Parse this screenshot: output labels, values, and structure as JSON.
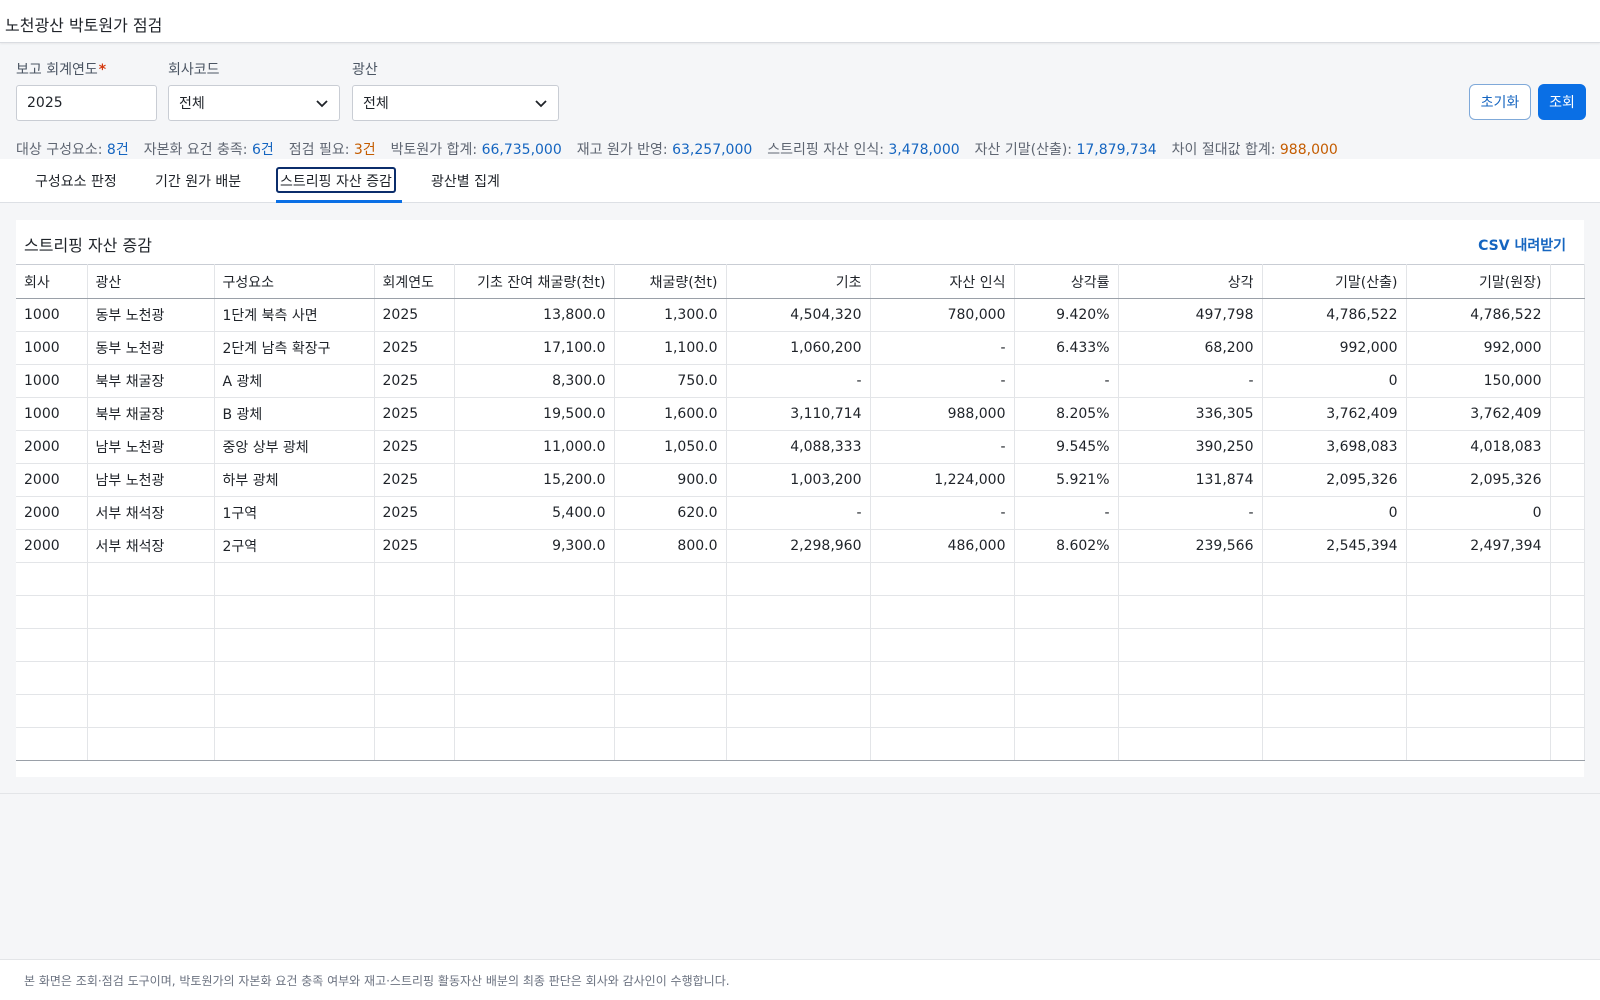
{
  "header": {
    "title": "노천광산 박토원가 점검"
  },
  "filters": {
    "year": {
      "label": "보고 회계연도",
      "required_mark": "*",
      "value": "2025"
    },
    "company": {
      "label": "회사코드",
      "value": "전체"
    },
    "mine": {
      "label": "광산",
      "value": "전체"
    },
    "reset_label": "초기화",
    "search_label": "조회"
  },
  "summary": [
    {
      "label": "대상 구성요소: ",
      "value": "8건",
      "tone": "blue"
    },
    {
      "label": "자본화 요건 충족: ",
      "value": "6건",
      "tone": "blue"
    },
    {
      "label": "점검 필요: ",
      "value": "3건",
      "tone": "orange"
    },
    {
      "label": "박토원가 합계: ",
      "value": "66,735,000",
      "tone": "blue"
    },
    {
      "label": "재고 원가 반영: ",
      "value": "63,257,000",
      "tone": "blue"
    },
    {
      "label": "스트리핑 자산 인식: ",
      "value": "3,478,000",
      "tone": "blue"
    },
    {
      "label": "자산 기말(산출): ",
      "value": "17,879,734",
      "tone": "blue"
    },
    {
      "label": "차이 절대값 합계: ",
      "value": "988,000",
      "tone": "orange"
    }
  ],
  "tabs": [
    "구성요소 판정",
    "기간 원가 배분",
    "스트리핑 자산 증감",
    "광산별 집계"
  ],
  "active_tab": 2,
  "panel": {
    "title": "스트리핑 자산 증감",
    "csv_label": "CSV 내려받기",
    "columns": [
      "회사",
      "광산",
      "구성요소",
      "회계연도",
      "기초 잔여 채굴량(천t)",
      "채굴량(천t)",
      "기초",
      "자산 인식",
      "상각률",
      "상각",
      "기말(산출)",
      "기말(원장)"
    ],
    "rows": [
      [
        "1000",
        "동부 노천광",
        "1단계 북측 사면",
        "2025",
        "13,800.0",
        "1,300.0",
        "4,504,320",
        "780,000",
        "9.420%",
        "497,798",
        "4,786,522",
        "4,786,522"
      ],
      [
        "1000",
        "동부 노천광",
        "2단계 남측 확장구",
        "2025",
        "17,100.0",
        "1,100.0",
        "1,060,200",
        "-",
        "6.433%",
        "68,200",
        "992,000",
        "992,000"
      ],
      [
        "1000",
        "북부 채굴장",
        "A 광체",
        "2025",
        "8,300.0",
        "750.0",
        "-",
        "-",
        "-",
        "-",
        "0",
        "150,000"
      ],
      [
        "1000",
        "북부 채굴장",
        "B 광체",
        "2025",
        "19,500.0",
        "1,600.0",
        "3,110,714",
        "988,000",
        "8.205%",
        "336,305",
        "3,762,409",
        "3,762,409"
      ],
      [
        "2000",
        "남부 노천광",
        "중앙 상부 광체",
        "2025",
        "11,000.0",
        "1,050.0",
        "4,088,333",
        "-",
        "9.545%",
        "390,250",
        "3,698,083",
        "4,018,083"
      ],
      [
        "2000",
        "남부 노천광",
        "하부 광체",
        "2025",
        "15,200.0",
        "900.0",
        "1,003,200",
        "1,224,000",
        "5.921%",
        "131,874",
        "2,095,326",
        "2,095,326"
      ],
      [
        "2000",
        "서부 채석장",
        "1구역",
        "2025",
        "5,400.0",
        "620.0",
        "-",
        "-",
        "-",
        "-",
        "0",
        "0"
      ],
      [
        "2000",
        "서부 채석장",
        "2구역",
        "2025",
        "9,300.0",
        "800.0",
        "2,298,960",
        "486,000",
        "8.602%",
        "239,566",
        "2,545,394",
        "2,497,394"
      ]
    ]
  },
  "footer": {
    "note": "본 화면은 조회·점검 도구이며, 박토원가의 자본화 요건 충족 여부와 재고·스트리핑 활동자산 배분의 최종 판단은 회사와 감사인이 수행합니다."
  },
  "icons": {
    "dropdown": "chevron-down-icon"
  },
  "colors": {
    "accent": "#0a6fe5",
    "link": "#1565c0",
    "warning": "#c45c00"
  }
}
